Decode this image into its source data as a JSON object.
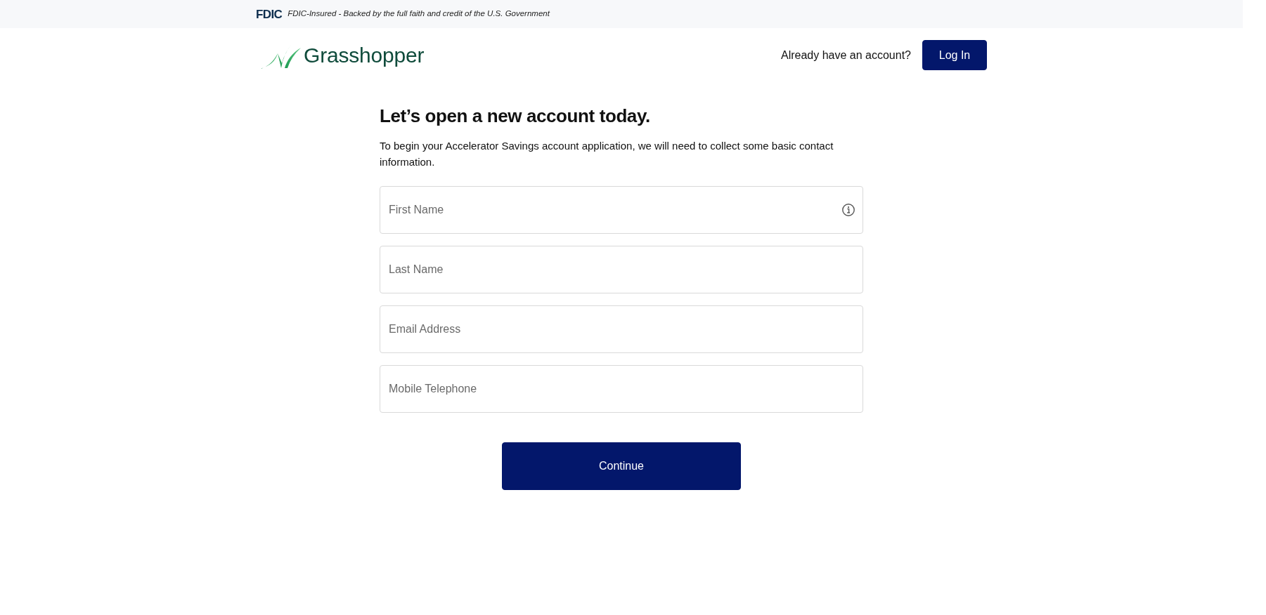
{
  "top_bar": {
    "fdic_logo": "FDIC",
    "notice": "FDIC-Insured - Backed by the full faith and credit of the U.S. Government"
  },
  "header": {
    "logo_text": "Grasshopper",
    "prompt": "Already have an account?",
    "login_button": "Log In"
  },
  "form": {
    "heading": "Let’s open a new account today.",
    "intro": "To begin your Accelerator Savings account application, we will need to collect some basic contact information.",
    "fields": [
      {
        "placeholder": "First Name",
        "info": true
      },
      {
        "placeholder": "Last Name",
        "info": false
      },
      {
        "placeholder": "Email Address",
        "info": false
      },
      {
        "placeholder": "Mobile Telephone",
        "info": false
      }
    ],
    "submit_button": "Continue"
  }
}
